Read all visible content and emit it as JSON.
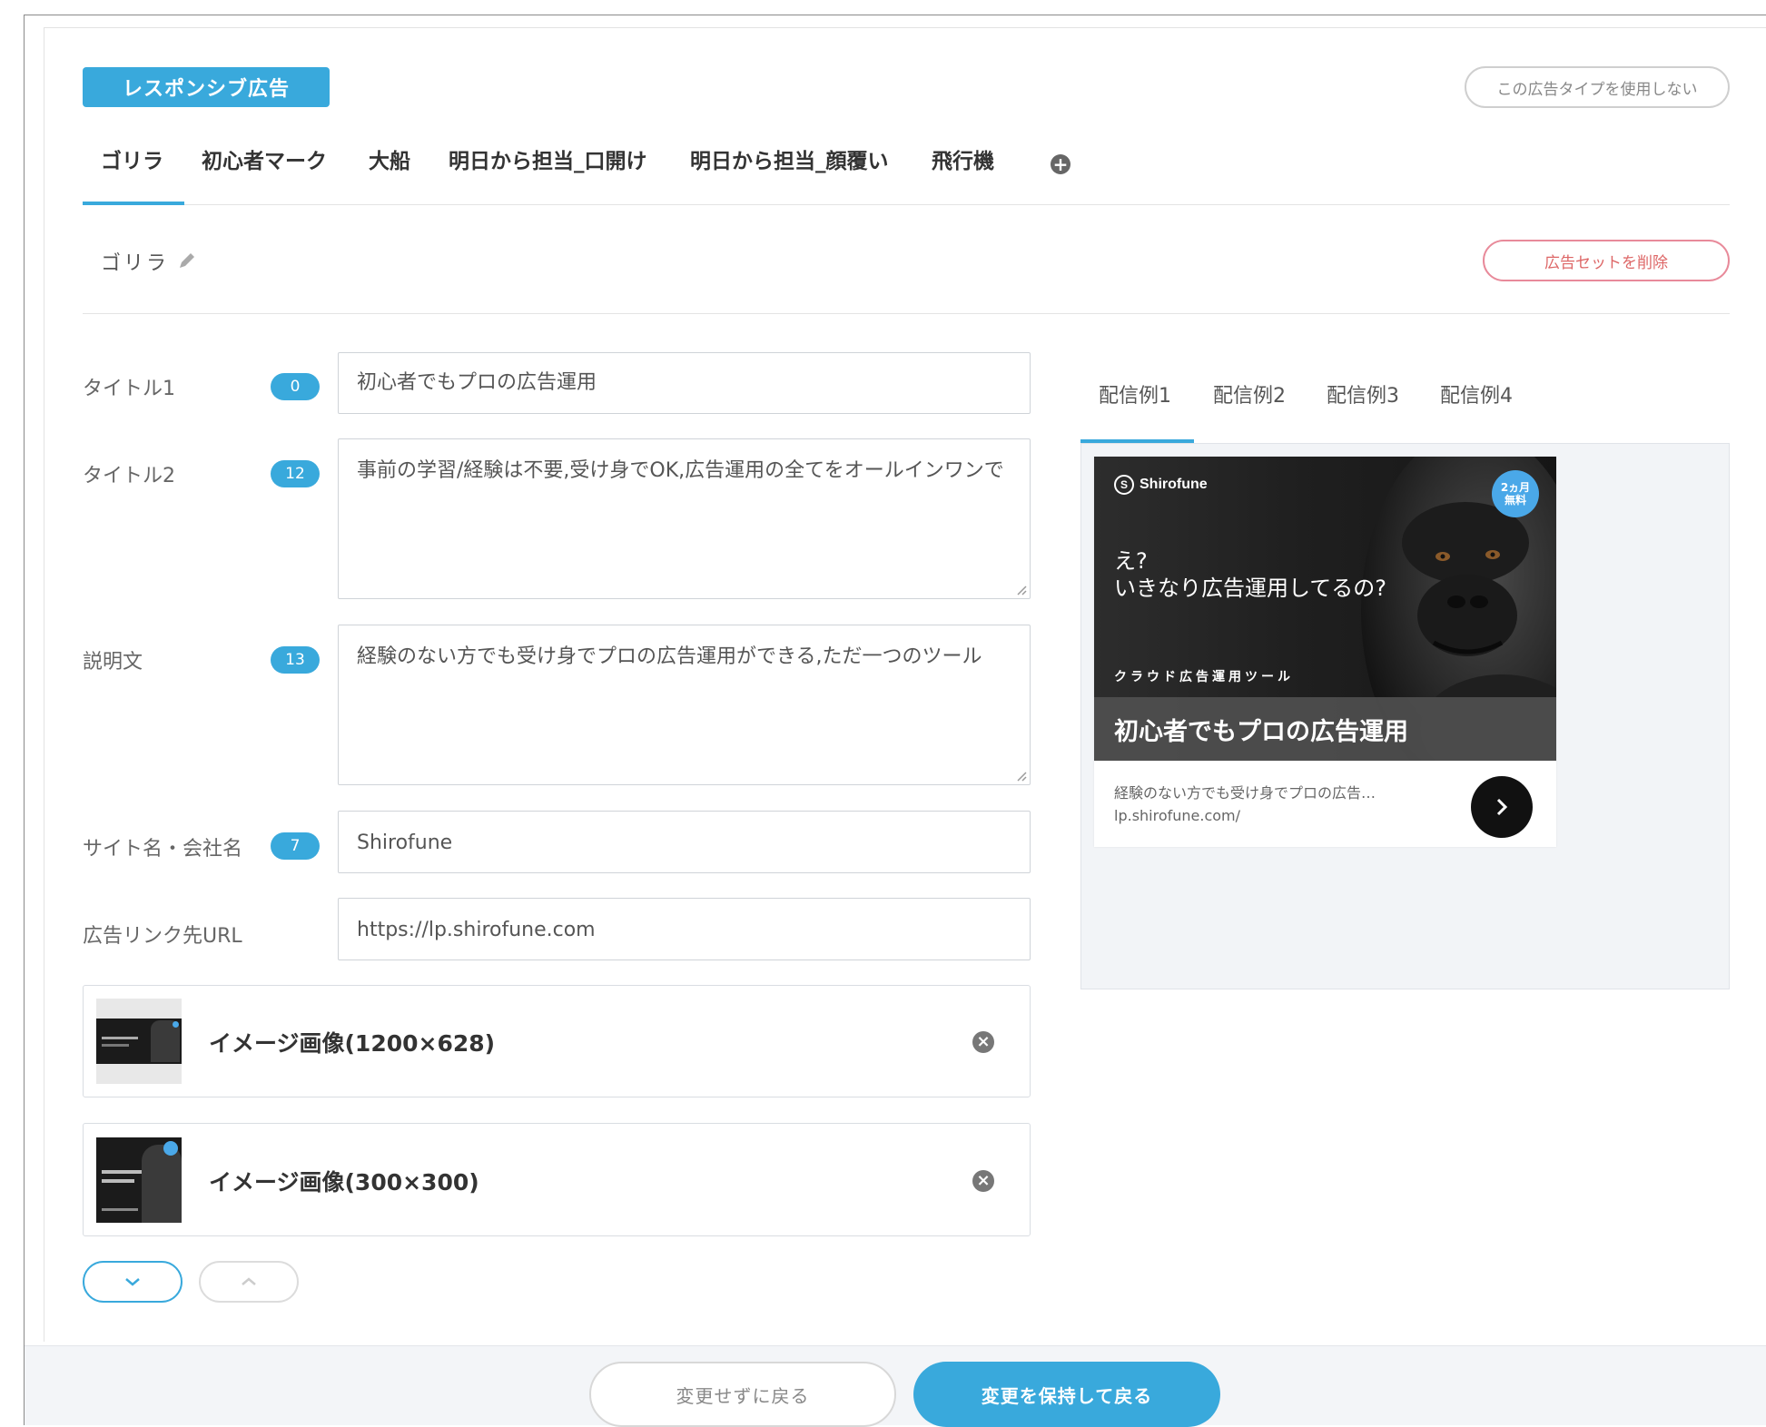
{
  "ad_type": {
    "label": "レスポンシブ広告",
    "disable_button": "この広告タイプを使用しない"
  },
  "ad_set_tabs": [
    {
      "label": "ゴリラ",
      "active": true
    },
    {
      "label": "初心者マーク"
    },
    {
      "label": "大船"
    },
    {
      "label": "明日から担当_口開け"
    },
    {
      "label": "明日から担当_顔覆い"
    },
    {
      "label": "飛行機"
    }
  ],
  "ad_set": {
    "name": "ゴリラ",
    "delete_button": "広告セットを削除"
  },
  "fields": {
    "title1": {
      "label": "タイトル1",
      "count": "0",
      "value": "初心者でもプロの広告運用"
    },
    "title2": {
      "label": "タイトル2",
      "count": "12",
      "value": "事前の学習/経験は不要,受け身でOK,広告運用の全てをオールインワンで"
    },
    "description": {
      "label": "説明文",
      "count": "13",
      "value": "経験のない方でも受け身でプロの広告運用ができる,ただ一つのツール"
    },
    "site_name": {
      "label": "サイト名・会社名",
      "count": "7",
      "value": "Shirofune"
    },
    "link_url": {
      "label": "広告リンク先URL",
      "value": "https://lp.shirofune.com"
    }
  },
  "images": [
    {
      "label": "イメージ画像(1200×628)"
    },
    {
      "label": "イメージ画像(300×300)"
    }
  ],
  "preview": {
    "tabs": [
      "配信例1",
      "配信例2",
      "配信例3",
      "配信例4"
    ],
    "active_tab": 0,
    "ad": {
      "brand": "Shirofune",
      "promo_line1": "2ヵ月",
      "promo_line2": "無料",
      "catch_line1": "え?",
      "catch_line2": "いきなり広告運用してるの?",
      "tagline": "クラウド広告運用ツール",
      "headline": "初心者でもプロの広告運用",
      "description": "経験のない方でも受け身でプロの広告…",
      "display_url": "lp.shirofune.com/"
    }
  },
  "footer": {
    "discard_button": "変更せずに戻る",
    "save_button": "変更を保持して戻る"
  },
  "colors": {
    "accent": "#39a9dc",
    "danger": "#e88a9a"
  },
  "icons": {
    "edit": "pencil-icon",
    "add_tab": "plus-circle-icon",
    "remove": "close-circle-icon",
    "expand": "chevron-down-icon",
    "collapse": "chevron-up-icon",
    "ad_cta": "chevron-right-icon"
  }
}
